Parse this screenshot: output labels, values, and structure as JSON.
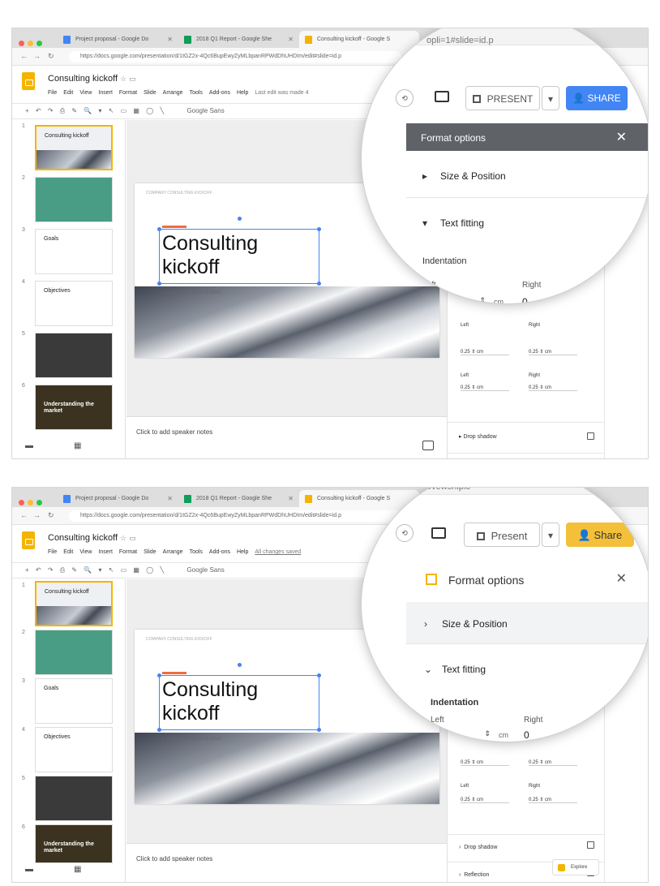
{
  "colors": {
    "chrome_bg": "#dedede",
    "old_share": "#4285f4",
    "new_share": "#f4c03a",
    "old_panel_header": "#5f6368",
    "selection_blue": "#4285f4",
    "slides_yellow": "#f4b400",
    "thumb_green": "#4a9d85",
    "thumb_dark": "#3a3a3a",
    "thumb_gold": "#3b3220"
  },
  "browser": {
    "tabs": [
      {
        "label": "Project proposal - Google Do",
        "icon": "docs-icon"
      },
      {
        "label": "2018 Q1 Report - Google She",
        "icon": "sheets-icon"
      },
      {
        "label": "Consulting kickoff - Google S",
        "icon": "slides-icon"
      }
    ],
    "url": "https://docs.google.com/presentation/d/1tGZ2x-4Qc6BupEwyZyMLbpanRPWdDhUHDIm/edit#slide=id.p",
    "url_zoomed_old": "opli=1#slide=id.p",
    "url_zoomed_new": "ovewsnipio"
  },
  "doc": {
    "title": "Consulting kickoff",
    "menus": [
      "File",
      "Edit",
      "View",
      "Insert",
      "Format",
      "Slide",
      "Arrange",
      "Tools",
      "Add-ons",
      "Help"
    ],
    "last_edit_old": "Last edit was made 4",
    "last_edit_new": "All changes saved",
    "toolbar_font": "Google Sans",
    "toolbar_glyphs": "+ ↶ ↷ ⎙ ✎ 🔍 ▾ ↖ ▭ ▦ ◯ ╲"
  },
  "thumbs": [
    {
      "num": "1",
      "title": "Consulting kickoff",
      "kind": "mountain"
    },
    {
      "num": "2",
      "title": "",
      "kind": "green"
    },
    {
      "num": "3",
      "title": "Goals",
      "kind": "white"
    },
    {
      "num": "4",
      "title": "Objectives",
      "kind": "white"
    },
    {
      "num": "5",
      "title": "",
      "kind": "dark"
    },
    {
      "num": "6",
      "title": "Understanding the market",
      "kind": "gold"
    }
  ],
  "slide": {
    "header_text": "COMPANY      CONSULTING KICKOFF",
    "title_line1": "Consulting",
    "title_line2": "kickoff",
    "subtitle": "Lorem ipsum dolor sit amet"
  },
  "notes": {
    "placeholder": "Click to add speaker notes"
  },
  "explore": {
    "label": "Explore"
  },
  "toolbar_old": {
    "present": "PRESENT",
    "share": "SHARE"
  },
  "toolbar_new": {
    "present": "Present",
    "share": "Share"
  },
  "format_options": {
    "title": "Format options",
    "size_position": "Size & Position",
    "text_fitting": "Text fitting",
    "indentation": "Indentation",
    "left": "Left",
    "right": "Right",
    "left_value": "0",
    "right_value": "0",
    "unit": "cm",
    "padding_top": "0.25",
    "padding_bottom": "0.25",
    "padding_left": "0.25",
    "padding_right": "0.25",
    "drop_shadow": "Drop shadow",
    "reflection": "Reflection"
  }
}
